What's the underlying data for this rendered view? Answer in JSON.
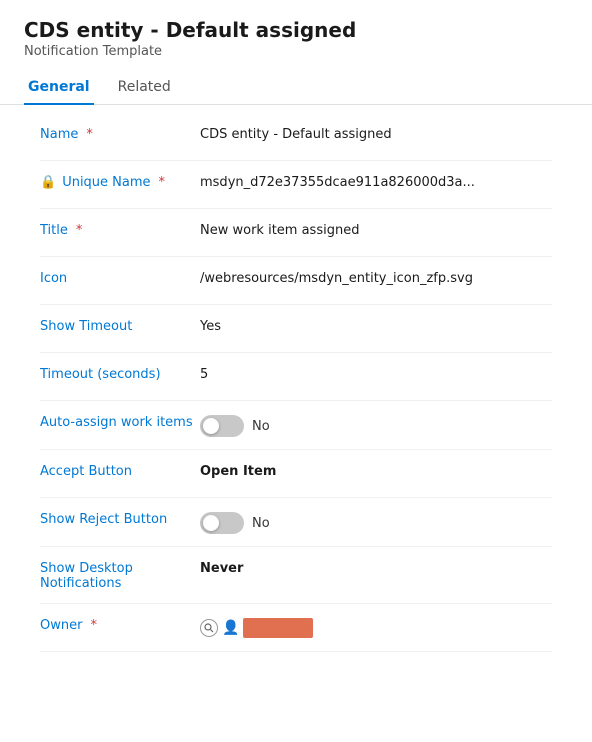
{
  "header": {
    "title": "CDS entity - Default assigned",
    "subtitle": "Notification Template"
  },
  "tabs": [
    {
      "id": "general",
      "label": "General",
      "active": true
    },
    {
      "id": "related",
      "label": "Related",
      "active": false
    }
  ],
  "form": {
    "fields": [
      {
        "label": "Name",
        "required": true,
        "type": "text",
        "value": "CDS entity - Default assigned",
        "bold": false
      },
      {
        "label": "Unique Name",
        "required": true,
        "type": "text-lock",
        "value": "msdyn_d72e37355dcae911a826000d3a...",
        "bold": false
      },
      {
        "label": "Title",
        "required": true,
        "type": "text",
        "value": "New work item assigned",
        "bold": false
      },
      {
        "label": "Icon",
        "required": false,
        "type": "text",
        "value": "/webresources/msdyn_entity_icon_zfp.svg",
        "bold": false
      },
      {
        "label": "Show Timeout",
        "required": false,
        "type": "text",
        "value": "Yes",
        "bold": false
      },
      {
        "label": "Timeout (seconds)",
        "required": false,
        "type": "text",
        "value": "5",
        "bold": false
      },
      {
        "label": "Auto-assign work items",
        "required": false,
        "type": "toggle",
        "toggleOn": false,
        "toggleLabel": "No"
      },
      {
        "label": "Accept Button",
        "required": false,
        "type": "text",
        "value": "Open Item",
        "bold": true
      },
      {
        "label": "Show Reject Button",
        "required": false,
        "type": "toggle",
        "toggleOn": false,
        "toggleLabel": "No"
      },
      {
        "label": "Show Desktop Notifications",
        "required": false,
        "type": "text",
        "value": "Never",
        "bold": true
      },
      {
        "label": "Owner",
        "required": true,
        "type": "owner"
      }
    ]
  },
  "icons": {
    "lock": "🔒",
    "required_star": "*"
  },
  "colors": {
    "accent": "#0078d4",
    "required": "#d13438",
    "lock": "#c8a000",
    "owner_bar": "#e07050"
  }
}
